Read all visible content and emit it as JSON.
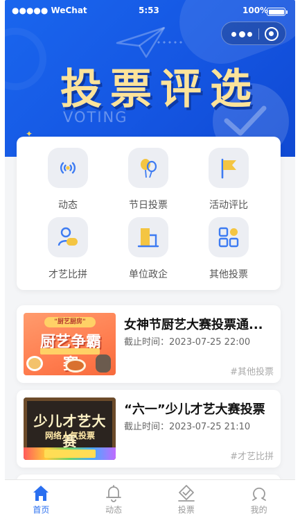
{
  "status_bar": {
    "carrier": "●●●●● WeChat",
    "time": "5:53",
    "battery": "100%"
  },
  "banner": {
    "title": "投票评选",
    "subtitle": "VOTING"
  },
  "categories": [
    {
      "label": "动态",
      "icon": "broadcast-icon"
    },
    {
      "label": "节日投票",
      "icon": "balloons-icon"
    },
    {
      "label": "活动评比",
      "icon": "flag-icon"
    },
    {
      "label": "才艺比拼",
      "icon": "person-card-icon"
    },
    {
      "label": "单位政企",
      "icon": "building-icon"
    },
    {
      "label": "其他投票",
      "icon": "grid-icon"
    }
  ],
  "votes": [
    {
      "title": "女神节厨艺大赛投票通...",
      "deadline": "截止时间：2023-07-25 22:00",
      "tag": "#其他投票",
      "thumb": {
        "top": "\"厨艺厨房\"",
        "main": "厨艺争霸赛"
      }
    },
    {
      "title": "“六一”少儿才艺大赛投票",
      "deadline": "截止时间：2023-07-25 21:10",
      "tag": "#才艺比拼",
      "thumb": {
        "main": "少儿才艺大赛",
        "sub": "网络人气投票"
      }
    }
  ],
  "tabs": [
    {
      "label": "首页",
      "icon": "home-icon",
      "active": true
    },
    {
      "label": "动态",
      "icon": "bell-icon",
      "active": false
    },
    {
      "label": "投票",
      "icon": "vote-icon",
      "active": false
    },
    {
      "label": "我的",
      "icon": "user-icon",
      "active": false
    }
  ],
  "colors": {
    "accent": "#2a6ff0",
    "banner": "#1556e2",
    "icon_yellow": "#f4c542",
    "icon_blue": "#3d7bf2"
  }
}
